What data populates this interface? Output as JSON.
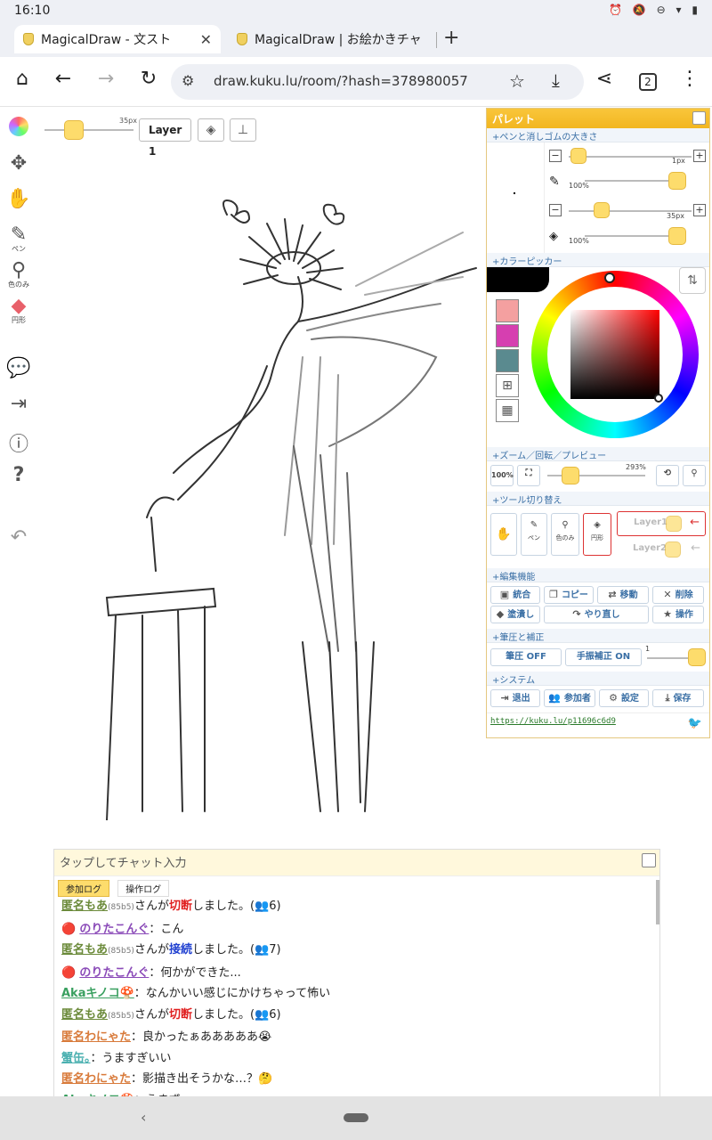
{
  "status": {
    "time": "16:10",
    "icons": "⏰ 🔕 ⊖ ▾ ▮"
  },
  "tabs": [
    {
      "title": "MagicalDraw - 文スト",
      "close": "✕"
    },
    {
      "title": "MagicalDraw | お絵かきチャ",
      "close": "✕"
    }
  ],
  "new_tab": "+",
  "toolbar": {
    "home": "⌂",
    "back": "←",
    "forward": "→",
    "reload": "↻",
    "url": "draw.kuku.lu/room/?hash=378980057",
    "tab_count": "2",
    "share": "⋖",
    "menu": "⋮"
  },
  "canvas": {
    "size_label": "35px",
    "layer_button": "Layer 1",
    "tools": {
      "pen": "ペン",
      "picker": "色のみ",
      "shape": "円形"
    }
  },
  "palette": {
    "title": "パレット",
    "sections": {
      "pen_size": "+ペンと消しゴムの大きさ",
      "color": "+カラーピッカー",
      "zoom": "+ズーム／回転／プレビュー",
      "tool_switch": "+ツール切り替え",
      "edit": "+編集機能",
      "pressure": "+筆圧と補正",
      "system": "+システム"
    },
    "pen_size": "1px",
    "pen_opacity": "100%",
    "eraser_size": "35px",
    "eraser_opacity": "100%",
    "swatches": [
      "#f4a0a0",
      "#d63fb0",
      "#5a8a8f"
    ],
    "zoom_value": "293%",
    "zoom_100": "100%",
    "tool_labels": {
      "pen": "ペン",
      "picker": "色のみ",
      "shape": "円形"
    },
    "layers": [
      "Layer1",
      "Layer2"
    ],
    "edit_buttons": {
      "merge": "統合",
      "copy": "コピー",
      "move": "移動",
      "delete": "削除",
      "fill": "塗潰し",
      "redo": "やり直し",
      "action": "操作"
    },
    "pressure_off": "筆圧 OFF",
    "stabilizer_on": "手振補正 ON",
    "stabilizer_value": "1",
    "system_buttons": {
      "exit": "退出",
      "members": "参加者",
      "settings": "設定",
      "save": "保存"
    },
    "link": "https://kuku.lu/p11696c6d9"
  },
  "chat": {
    "placeholder": "タップしてチャット入力",
    "tabs": [
      "参加ログ",
      "操作ログ"
    ],
    "messages": [
      {
        "name": "匿名もあ",
        "hash": "(85b5)",
        "pre": "さんが",
        "event": "切断",
        "post": "しました。(👥6)",
        "name_color": "#6b8a3a",
        "event_color": "#e02020"
      },
      {
        "name": "のりたこんぐ",
        "icon": "🔴",
        "sep": "：",
        "text": "こん",
        "name_color": "#8a4ab8"
      },
      {
        "name": "匿名もあ",
        "hash": "(85b5)",
        "pre": "さんが",
        "event": "接続",
        "post": "しました。(👥7)",
        "name_color": "#6b8a3a",
        "event_color": "#2040d0"
      },
      {
        "name": "のりたこんぐ",
        "icon": "🔴",
        "sep": "：",
        "text": "何かができた...",
        "name_color": "#8a4ab8"
      },
      {
        "name": "Akaキノコ🍄",
        "sep": "：",
        "text": "なんかいい感じにかけちゃって怖い",
        "name_color": "#3aa060"
      },
      {
        "name": "匿名もあ",
        "hash": "(85b5)",
        "pre": "さんが",
        "event": "切断",
        "post": "しました。(👥6)",
        "name_color": "#6b8a3a",
        "event_color": "#e02020"
      },
      {
        "name": "匿名わにゃた",
        "sep": "：",
        "text": "良かったぁあああああ😭",
        "name_color": "#d87a3a"
      },
      {
        "name": "蟹缶。",
        "sep": "：",
        "text": "うますぎいい",
        "name_color": "#4ab0b0"
      },
      {
        "name": "匿名わにゃた",
        "sep": "：",
        "text": "影描き出そうかな…？🤔",
        "name_color": "#d87a3a"
      },
      {
        "name": "Akaキノコ🍄",
        "sep": "：",
        "text": "うまず",
        "name_color": "#3aa060"
      }
    ]
  }
}
